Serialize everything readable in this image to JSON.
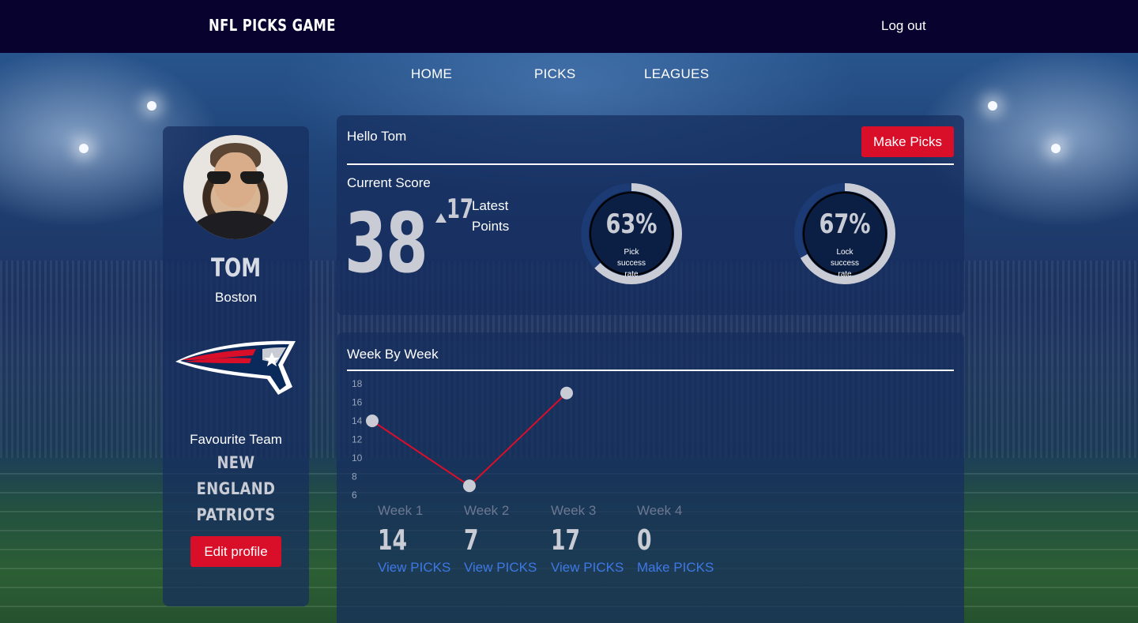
{
  "header": {
    "brand": "NFL PICKS GAME",
    "logout_label": "Log out"
  },
  "nav": {
    "items": [
      "HOME",
      "PICKS",
      "LEAGUES"
    ]
  },
  "profile": {
    "name": "TOM",
    "city": "Boston",
    "favourite_label": "Favourite Team",
    "favourite_team_line1": "NEW ENGLAND",
    "favourite_team_line2": "PATRIOTS",
    "edit_label": "Edit profile"
  },
  "score": {
    "greeting": "Hello Tom",
    "make_picks_label": "Make Picks",
    "current_label": "Current Score",
    "current_value": "38",
    "latest_points": "17",
    "latest_label_line1": "Latest",
    "latest_label_line2": "Points",
    "gauges": [
      {
        "percent": 63,
        "label": "63%",
        "caption_line1": "Pick",
        "caption_line2": "success",
        "caption_line3": "rate"
      },
      {
        "percent": 67,
        "label": "67%",
        "caption_line1": "Lock",
        "caption_line2": "success",
        "caption_line3": "rate"
      }
    ]
  },
  "week_by_week": {
    "title": "Week By Week",
    "weeks": [
      {
        "name": "Week 1",
        "score": "14",
        "link": "View PICKS"
      },
      {
        "name": "Week 2",
        "score": "7",
        "link": "View PICKS"
      },
      {
        "name": "Week 3",
        "score": "17",
        "link": "View PICKS"
      },
      {
        "name": "Week 4",
        "score": "0",
        "link": "Make PICKS"
      }
    ]
  },
  "chart_data": {
    "type": "line",
    "x": [
      "Week 1",
      "Week 2",
      "Week 3"
    ],
    "series": [
      {
        "values": [
          14,
          7,
          17
        ]
      }
    ],
    "yticks": [
      6,
      8,
      10,
      12,
      14,
      16,
      18
    ],
    "ylim": [
      6,
      18
    ],
    "grid": false,
    "line_color": "#d90f2a",
    "point_color": "#c9ccd4"
  },
  "colors": {
    "topbar": "#07022e",
    "accent_red": "#d90f2a",
    "link_blue": "#3d78e6",
    "numeral_gray": "#c9ccd4"
  },
  "icons": {
    "team_logo": "patriots-logo-icon",
    "avatar": "user-avatar"
  }
}
